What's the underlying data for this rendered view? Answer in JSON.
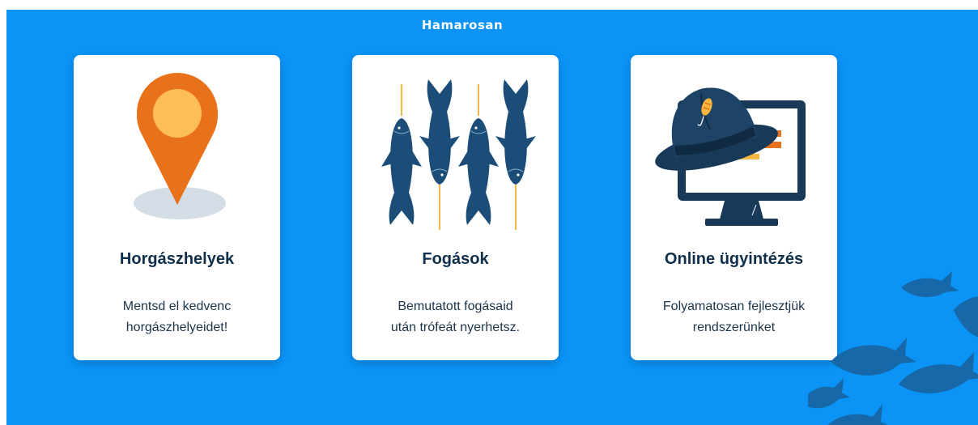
{
  "header": {
    "title": "Hamarosan"
  },
  "cards": [
    {
      "icon": "map-pin-icon",
      "title": "Horgászhelyek",
      "text_lines": [
        "Mentsd el kedvenc",
        "horgászhelyeidet!"
      ]
    },
    {
      "icon": "hanging-fish-icon",
      "title": "Fogások",
      "text_lines": [
        "Bemutatott fogásaid",
        "után trófeát nyerhetsz."
      ]
    },
    {
      "icon": "hat-and-monitor-icon",
      "title": "Online ügyintézés",
      "text_lines": [
        "Folyamatosan fejlesztjük",
        "rendszerünket"
      ]
    }
  ],
  "decoration": {
    "icon": "fish-school-icon"
  },
  "colors": {
    "background": "#0b93f6",
    "card": "#ffffff",
    "heading": "#0f2f4b",
    "pin_orange": "#e8721c",
    "pin_inner": "#ffbd5a",
    "fish_navy": "#1b4d78",
    "dark_navy": "#183a58",
    "fish_silhouette": "#1668a8"
  }
}
